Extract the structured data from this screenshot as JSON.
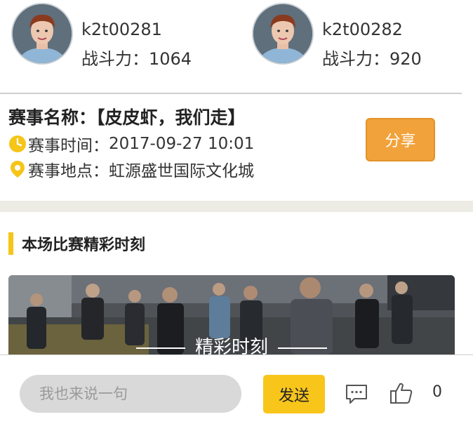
{
  "players": [
    {
      "name": "k2t00281",
      "power_label": "战斗力：",
      "power": "1064"
    },
    {
      "name": "k2t00282",
      "power_label": "战斗力：",
      "power": "920"
    }
  ],
  "match": {
    "title": "赛事名称：【皮皮虾，我们走】",
    "time_label": "赛事时间：",
    "time_value": "2017-09-27 10:01",
    "place_label": "赛事地点：",
    "place_value": "虹源盛世国际文化城",
    "share_label": "分享",
    "icons": {
      "time": "clock-icon",
      "place": "location-pin-icon"
    },
    "accent_color": "#f5c518"
  },
  "highlights": {
    "section_title": "本场比赛精彩时刻",
    "caption": "精彩时刻"
  },
  "footer": {
    "input_placeholder": "我也来说一句",
    "send_label": "发送",
    "comment_icon": "comment-icon",
    "like_icon": "thumbs-up-icon",
    "like_count": "0"
  },
  "colors": {
    "share_button": "#f2a23a",
    "send_button": "#f8c51b",
    "section_bar": "#f5c518",
    "band": "#ecebe4"
  }
}
